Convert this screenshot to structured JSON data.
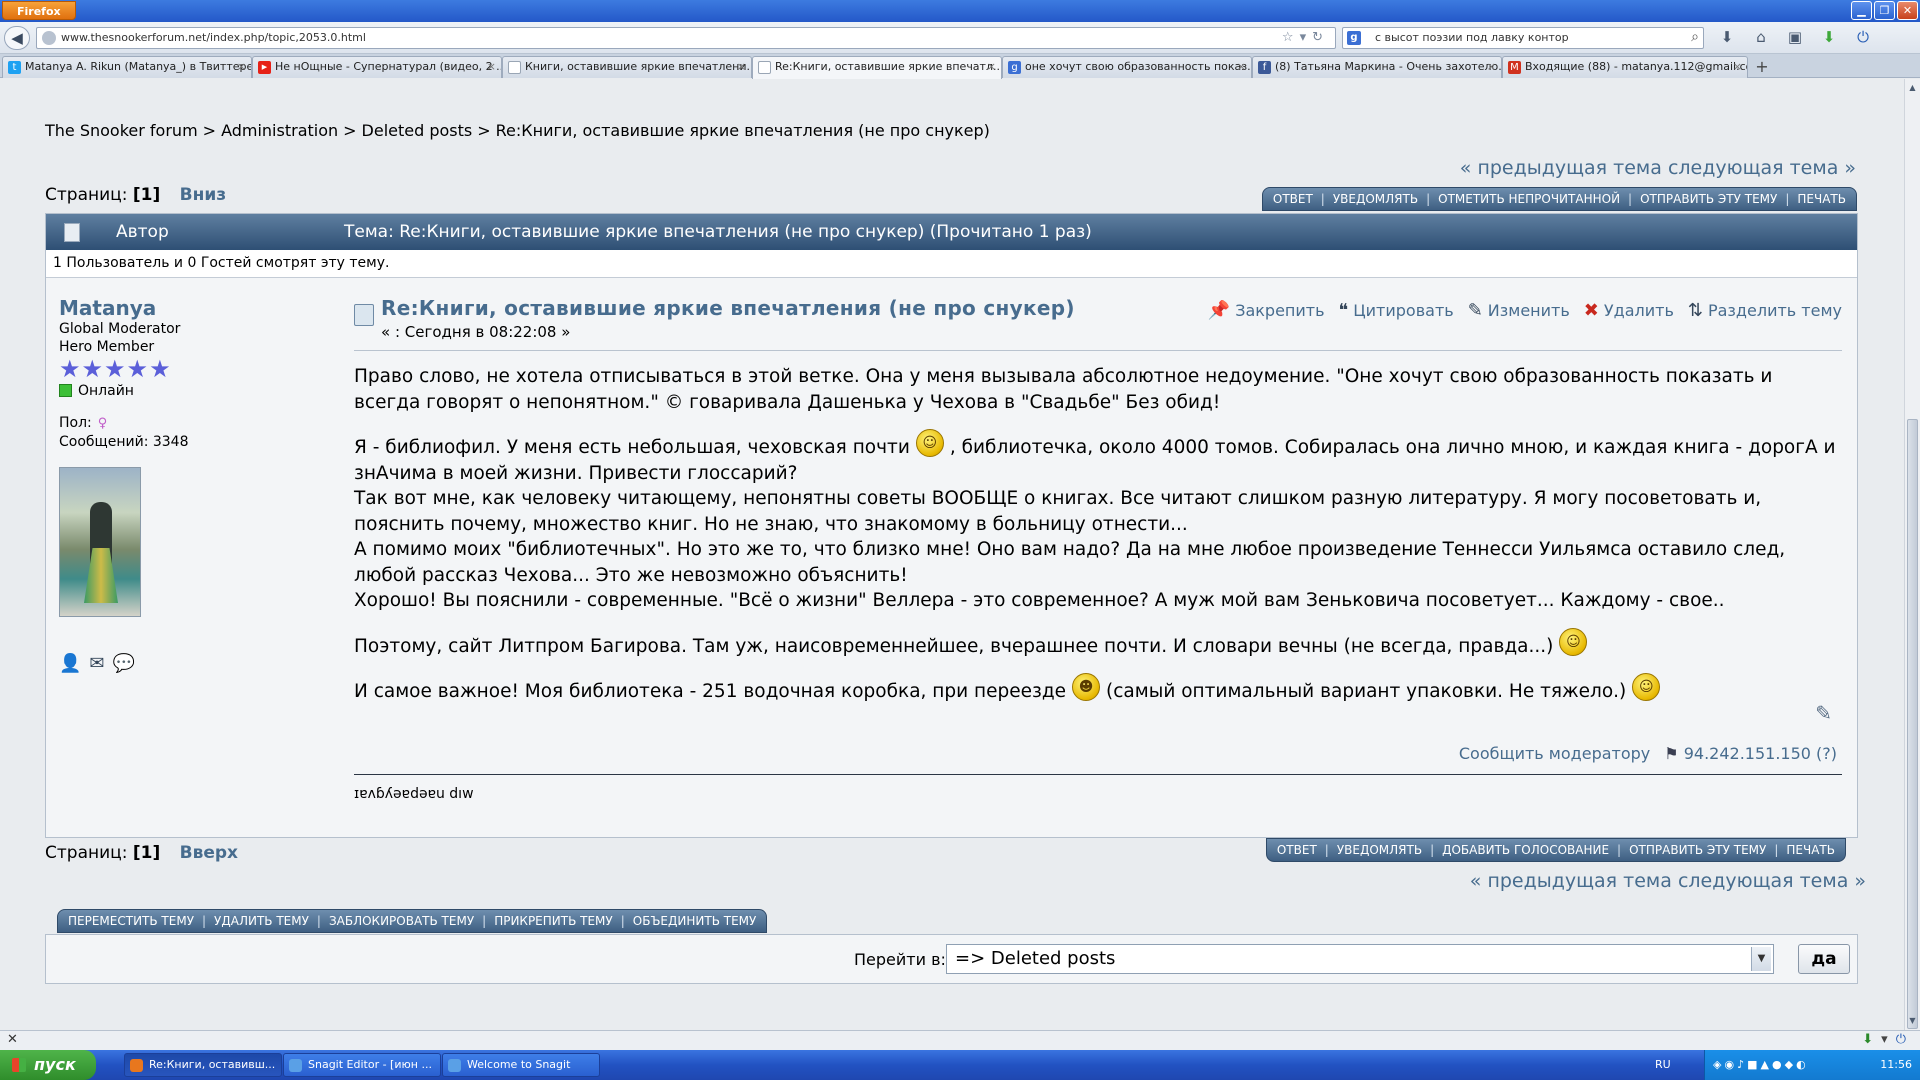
{
  "browser": {
    "menu_label": "Firefox",
    "url": "www.thesnookerforum.net/index.php/topic,2053.0.html",
    "search_text": "с высот поэзии под лавку контор",
    "search_engine_glyph": "g",
    "tabs": [
      {
        "label": "Matanya A. Rikun (Matanya_) в Твиттере",
        "icon_color": "#1da1f2",
        "icon_glyph": "t"
      },
      {
        "label": "Не нОщные - Супернатурал (видео, 2 ...",
        "icon_color": "#e62117",
        "icon_glyph": "▶"
      },
      {
        "label": "Книги, оставившие яркие впечатлени...",
        "icon_color": "#9aa6b5",
        "icon_glyph": ""
      },
      {
        "label": "Re:Книги, оставившие яркие впечатл...",
        "icon_color": "#9aa6b5",
        "icon_glyph": ""
      },
      {
        "label": "оне хочут свою образованность показ...",
        "icon_color": "#3b6fd4",
        "icon_glyph": "g"
      },
      {
        "label": "(8) Татьяна Маркина - Очень захотело...",
        "icon_color": "#3b5998",
        "icon_glyph": "f"
      },
      {
        "label": "Входящие (88) - matanya.112@gmail.co...",
        "icon_color": "#d0321f",
        "icon_glyph": "M"
      }
    ]
  },
  "forum": {
    "breadcrumb": [
      "The Snooker forum",
      "Administration",
      "Deleted posts",
      "Re:Книги, оставившие яркие впечатления (не про снукер)"
    ],
    "breadcrumb_sep": ">",
    "prev_topic": "« предыдущая тема",
    "next_topic": "следующая тема »",
    "pages_label": "Страниц:",
    "current_page": "[1]",
    "jump_down": "Вниз",
    "jump_up": "Вверх",
    "top_buttons": [
      "ОТВЕТ",
      "УВЕДОМЛЯТЬ",
      "ОТМЕТИТЬ НЕПРОЧИТАННОЙ",
      "ОТПРАВИТЬ ЭТУ ТЕМУ",
      "ПЕЧАТЬ"
    ],
    "bottom_buttons": [
      "ОТВЕТ",
      "УВЕДОМЛЯТЬ",
      "ДОБАВИТЬ ГОЛОСОВАНИЕ",
      "ОТПРАВИТЬ ЭТУ ТЕМУ",
      "ПЕЧАТЬ"
    ],
    "mod_buttons": [
      "ПЕРЕМЕСТИТЬ ТЕМУ",
      "УДАЛИТЬ ТЕМУ",
      "ЗАБЛОКИРОВАТЬ ТЕМУ",
      "ПРИКРЕПИТЬ ТЕМУ",
      "ОБЪЕДИНИТЬ ТЕМУ"
    ],
    "header_author": "Автор",
    "header_topic": "Тема: Re:Книги, оставившие яркие впечатления (не про снукер)  (Прочитано 1 раз)",
    "viewers": "1 Пользователь и 0 Гостей смотрят эту тему.",
    "jump_label": "Перейти в:",
    "jump_value": "=> Deleted posts",
    "go_label": "да"
  },
  "poster": {
    "name": "Matanya",
    "rank": "Global Moderator",
    "member_group": "Hero Member",
    "stars": "★★★★★",
    "status": "Онлайн",
    "gender_label": "Пол:",
    "gender_icon": "♀",
    "posts": "Сообщений: 3348"
  },
  "post": {
    "subject": "Re:Книги, оставившие яркие впечатления (не про снукер)",
    "date": "« : Сегодня в 08:22:08 »",
    "actions": [
      "Закрепить",
      "Цитировать",
      "Изменить",
      "Удалить",
      "Разделить тему"
    ],
    "p1": "Право слово, не хотела отписываться в этой ветке. Она у меня вызывала абсолютное недоумение. \"Оне хочут свою образованность показать и всегда говорят о непонятном.\" © говаривала Дашенька у Чехова в \"Свадьбе\" Без обид!",
    "p2a": "Я - библиофил. У меня есть небольшая, чеховская почти",
    "p2b": ", библиотечка, около 4000 томов. Собиралась она лично мною, и каждая книга - дорогА и знАчима в моей жизни. Привести глоссарий?",
    "p3": "Так вот мне, как человеку читающему, непонятны советы ВООБЩЕ о книгах. Все читают слишком разную литературу. Я могу посоветовать и, пояснить почему, множество книг. Но не знаю, что знакомому в больницу отнести...",
    "p4": "А помимо моих \"библиотечных\". Но это же то, что близко мне! Оно вам надо? Да на мне любое произведение Теннесси Уильямса оставило след, любой рассказ Чехова... Это же невозможно объяснить!",
    "p5": "Хорошо! Вы пояснили -  современные. \"Всё о жизни\" Веллера - это современное? А муж мой вам Зеньковича посоветует... Каждому - свое..",
    "p6": "Поэтому, сайт Литпром Багирова. Там уж, наисовременнейшее, вчерашнее почти. И словари вечны (не всегда, правда...)",
    "p7a": "И самое важное! Моя библиотека - 251 водочная коробка, при переезде",
    "p7b": "(самый оптимальный вариант упаковки. Не тяжело.)",
    "report": "Сообщить модератору",
    "ip": "94.242.151.150 (?)",
    "signature": "ɪɐʌɓʎǝɐdǝɐu dıw"
  },
  "taskbar": {
    "start": "пуск",
    "tasks": [
      "Re:Книги, оставивш...",
      "Snagit Editor - [июн ...",
      "Welcome to Snagit"
    ],
    "lang": "RU",
    "clock": "11:56"
  }
}
